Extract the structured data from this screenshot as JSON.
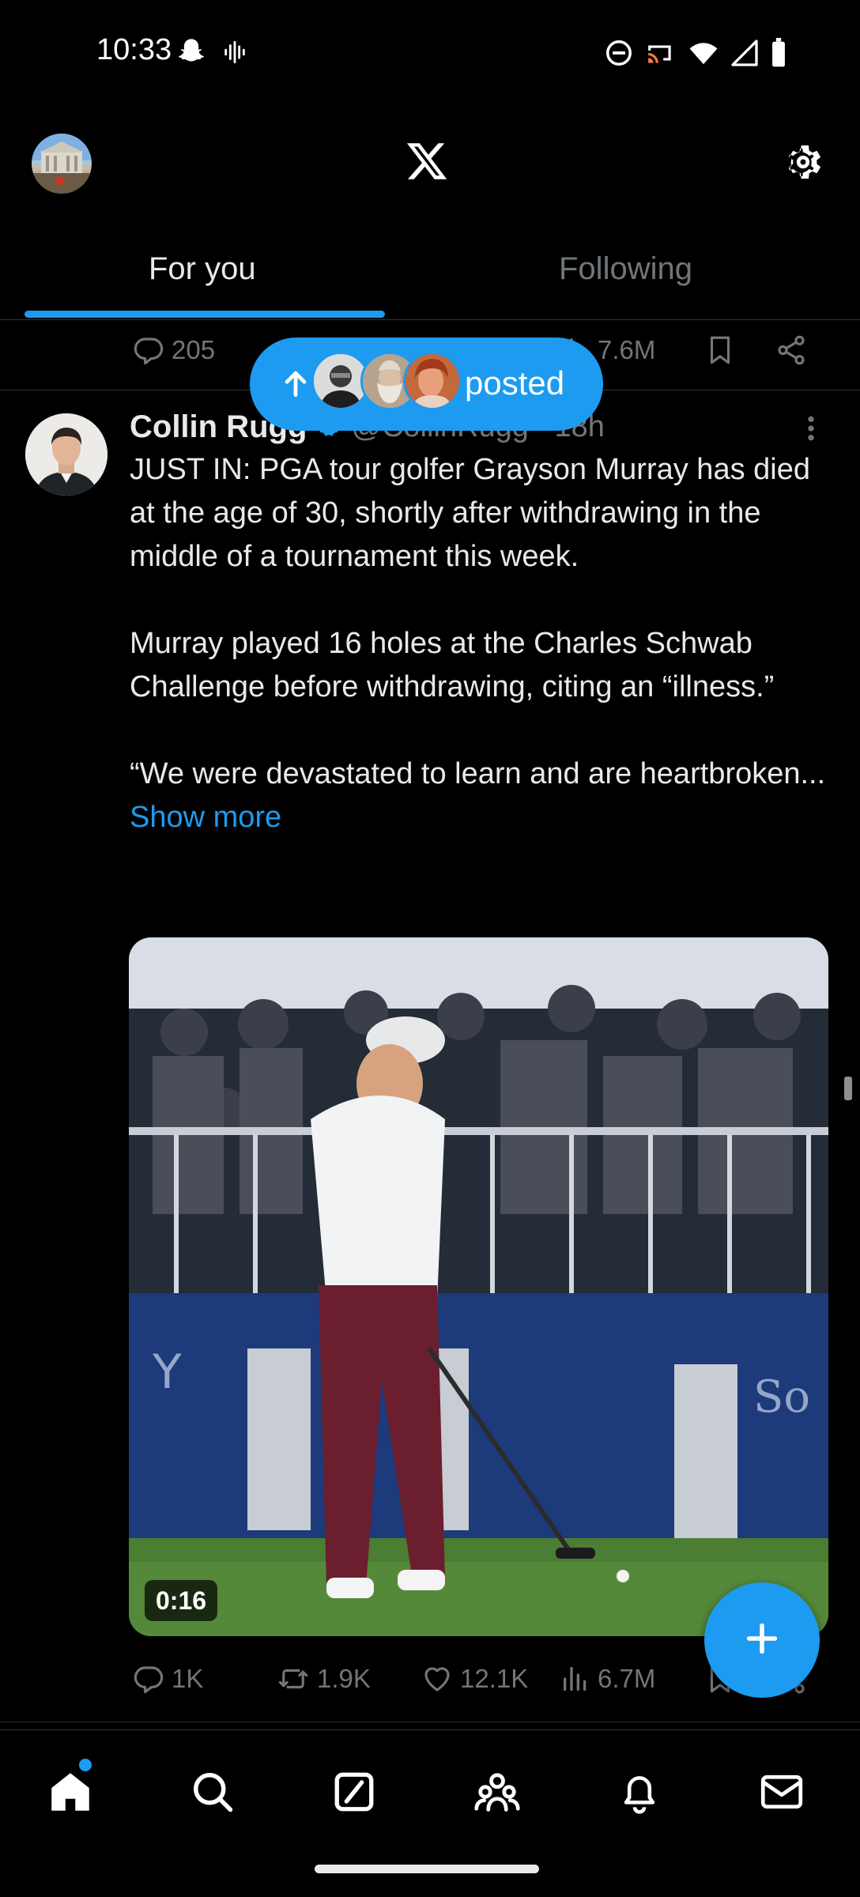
{
  "status_bar": {
    "time": "10:33",
    "left_icons": [
      "snapchat-ghost-icon",
      "audio-waveform-icon"
    ],
    "right_icons": [
      "do-not-disturb-icon",
      "cast-icon",
      "wifi-icon",
      "cell-signal-icon",
      "battery-icon"
    ]
  },
  "top_bar": {
    "avatar": "profile-avatar",
    "logo": "x-logo-icon",
    "settings": "gear-icon"
  },
  "tabs": [
    {
      "label": "For you",
      "active": true
    },
    {
      "label": "Following",
      "active": false
    }
  ],
  "previous_post": {
    "replies": "205",
    "views": "7.6M"
  },
  "new_posts_pill": {
    "label": "posted",
    "avatar_count": 3
  },
  "tweet": {
    "author_name": "Collin Rugg",
    "verified": true,
    "handle": "@CollinRugg",
    "separator": "·",
    "time": "18h",
    "paragraphs": [
      "JUST IN: PGA tour golfer Grayson Murray has died at the age of 30, shortly after withdrawing in the middle of a tournament this week.",
      "Murray played 16 holes at the Charles Schwab Challenge before withdrawing, citing an “illness.”",
      "“We were devastated to learn and are heartbroken..."
    ],
    "show_more": "Show more",
    "media": {
      "type": "video",
      "duration": "0:16"
    },
    "stats": {
      "replies": "1K",
      "reposts": "1.9K",
      "likes": "12.1K",
      "views": "6.7M"
    }
  },
  "fab": {
    "icon": "plus-icon"
  },
  "bottom_nav": {
    "items": [
      "home-icon",
      "search-icon",
      "grok-icon",
      "communities-icon",
      "notifications-icon",
      "messages-icon"
    ],
    "home_has_badge": true
  },
  "colors": {
    "background": "#000000",
    "accent": "#1d9bf0",
    "text_primary": "#e7e9ea",
    "text_secondary": "#71767b",
    "divider": "#2f3336"
  }
}
